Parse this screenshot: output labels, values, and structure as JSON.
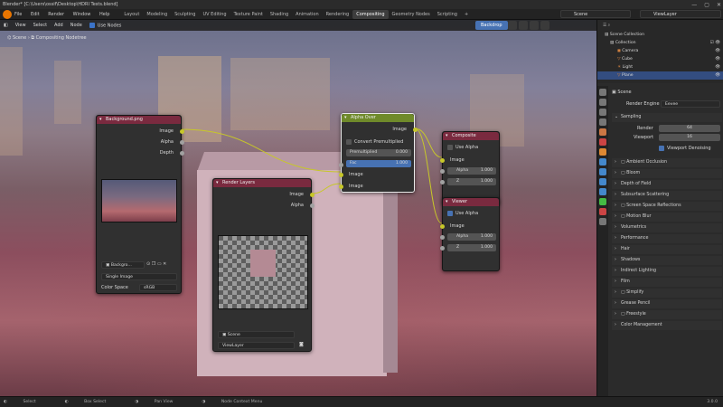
{
  "window": {
    "title": "Blender* [C:\\Users\\ossif\\Desktop\\HDRI Tests.blend]"
  },
  "menu": [
    "File",
    "Edit",
    "Render",
    "Window",
    "Help"
  ],
  "workspaces": [
    "Layout",
    "Modeling",
    "Sculpting",
    "UV Editing",
    "Texture Paint",
    "Shading",
    "Animation",
    "Rendering",
    "Compositing",
    "Geometry Nodes",
    "Scripting"
  ],
  "active_workspace": "Compositing",
  "scene_field": "Scene",
  "viewlayer_field": "ViewLayer",
  "node_header": {
    "items": [
      "View",
      "Select",
      "Add",
      "Node"
    ],
    "use_nodes": "Use Nodes",
    "backdrop": "Backdrop"
  },
  "breadcrumb": {
    "scene": "Scene",
    "tree": "Compositing Nodetree"
  },
  "nodes": {
    "background": {
      "title": "Background.png",
      "outputs": [
        "Image",
        "Alpha",
        "Depth"
      ],
      "image_name": "Backgro...",
      "source": "Single Image",
      "color_space_label": "Color Space",
      "color_space": "sRGB"
    },
    "render_layers": {
      "title": "Render Layers",
      "outputs": [
        "Image",
        "Alpha"
      ],
      "scene": "Scene",
      "view_layer": "ViewLayer"
    },
    "alpha_over": {
      "title": "Alpha Over",
      "output": "Image",
      "convert_label": "Convert Premultiplied",
      "premul_label": "Premultiplied",
      "premul_value": "0.000",
      "fac_label": "Fac",
      "fac_value": "1.000",
      "inputs": [
        "Image",
        "Image"
      ]
    },
    "composite": {
      "title": "Composite",
      "use_alpha": "Use Alpha",
      "inputs": [
        "Image"
      ],
      "alpha_label": "Alpha",
      "alpha_value": "1.000",
      "z_label": "Z",
      "z_value": "1.000"
    },
    "viewer": {
      "title": "Viewer",
      "use_alpha": "Use Alpha",
      "inputs": [
        "Image"
      ],
      "alpha_label": "Alpha",
      "alpha_value": "1.000",
      "z_label": "Z",
      "z_value": "1.000"
    }
  },
  "outliner": {
    "root": "Scene Collection",
    "collection": "Collection",
    "items": [
      "Camera",
      "Cube",
      "Light",
      "Plane"
    ],
    "selected": "Plane"
  },
  "properties": {
    "context": "Scene",
    "render_engine_label": "Render Engine",
    "render_engine": "Eevee",
    "sampling": "Sampling",
    "render_label": "Render",
    "render_value": "64",
    "viewport_label": "Viewport",
    "viewport_value": "16",
    "denoising": "Viewport Denoising",
    "panels": [
      "Ambient Occlusion",
      "Bloom",
      "Depth of Field",
      "Subsurface Scattering",
      "Screen Space Reflections",
      "Motion Blur",
      "Volumetrics",
      "Performance",
      "Hair",
      "Shadows",
      "Indirect Lighting",
      "Film",
      "Simplify",
      "Grease Pencil",
      "Freestyle",
      "Color Management"
    ]
  },
  "status": {
    "select": "Select",
    "box_select": "Box Select",
    "pan": "Pan View",
    "ctx": "Node Context Menu",
    "version": "3.0.0"
  },
  "colors": {
    "accent_blue": "#4772b3",
    "header_image": "#7a2a3f",
    "header_converter": "#6f8a2a",
    "header_output": "#7a2a3f",
    "socket_color": "#c7c729"
  }
}
